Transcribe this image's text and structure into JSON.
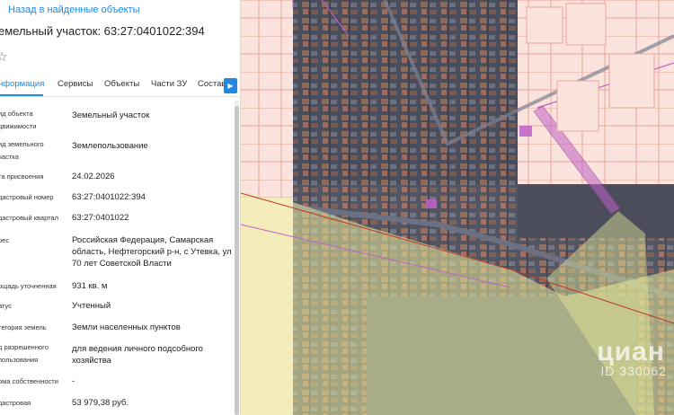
{
  "nav": {
    "back_label": "Назад в найденные объекты"
  },
  "object": {
    "title": "емельный участок: 63:27:0401022:394"
  },
  "tabs": {
    "items": [
      {
        "label": "нформация",
        "active": true
      },
      {
        "label": "Сервисы",
        "active": false
      },
      {
        "label": "Объекты",
        "active": false
      },
      {
        "label": "Части ЗУ",
        "active": false
      },
      {
        "label": "Состав",
        "active": false
      }
    ],
    "next_icon": "chevron-right-icon"
  },
  "fields": [
    {
      "label": "ид объекта движимости",
      "value": "Земельный участок"
    },
    {
      "label": "ид земельного частка",
      "value": "Землепользование"
    },
    {
      "label": "та присвоения",
      "value": "24.02.2026"
    },
    {
      "label": "дастровый номер",
      "value": "63:27:0401022:394"
    },
    {
      "label": "дастровый квартал",
      "value": "63:27:0401022"
    },
    {
      "label": "рес",
      "value": "Российская Федерация, Самарская область, Нефтегорский р-н, с Утевка, ул 70 лет Советской Власти"
    },
    {
      "label": "ощадь уточненная",
      "value": "931 кв. м"
    },
    {
      "label": "атус",
      "value": "Учтенный"
    },
    {
      "label": "тегория земель",
      "value": "Земли населенных пунктов"
    },
    {
      "label": "д разрешенного пользования",
      "value": "для ведения личного подсобного хозяйства"
    },
    {
      "label": "рма собственности",
      "value": "-"
    },
    {
      "label": "дастровая",
      "value": "53 979,38 руб."
    }
  ],
  "map": {
    "watermark": "циан",
    "watermark_id": "ID 330062",
    "colors": {
      "parcel_outline": "#c0392b",
      "highlight": "#c061c9",
      "farmland": "#e6ea9a",
      "link": "#1e88e5"
    }
  }
}
